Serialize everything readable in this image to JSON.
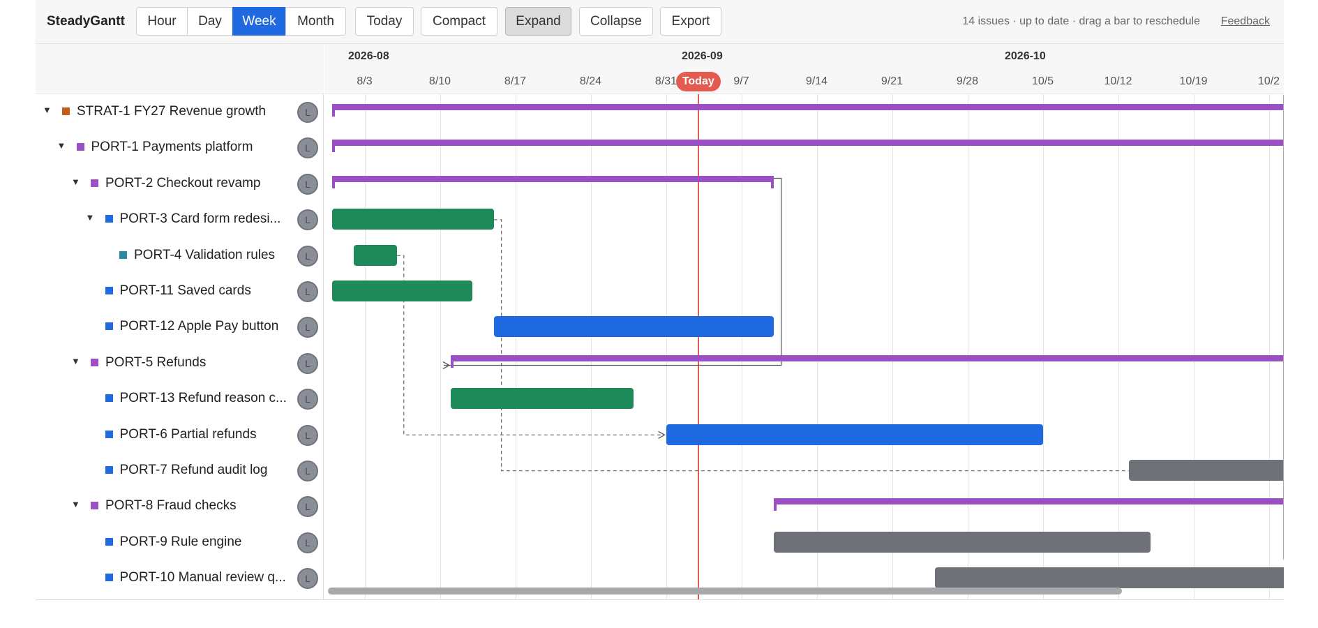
{
  "app": {
    "name": "SteadyGantt"
  },
  "toolbar": {
    "scale_buttons": [
      {
        "label": "Hour",
        "active": false
      },
      {
        "label": "Day",
        "active": false
      },
      {
        "label": "Week",
        "active": true
      },
      {
        "label": "Month",
        "active": false
      }
    ],
    "today_label": "Today",
    "compact_label": "Compact",
    "expand_label": "Expand",
    "expand_pressed": true,
    "collapse_label": "Collapse",
    "export_label": "Export",
    "status_text": "14 issues · up to date · drag a bar to reschedule",
    "feedback_label": "Feedback"
  },
  "timeline": {
    "months": [
      "2026-08",
      "2026-09",
      "2026-10"
    ],
    "weeks": [
      "8/3",
      "8/10",
      "8/17",
      "8/24",
      "8/31",
      "9/7",
      "9/14",
      "9/21",
      "9/28",
      "10/5",
      "10/12",
      "10/19",
      "10/2"
    ],
    "today_label": "Today",
    "today_date": "2026-09-03"
  },
  "colors": {
    "summary": "#9a4fc4",
    "done": "#1e8a5a",
    "in_progress": "#1f6ae0",
    "todo": "#6f7178",
    "today": "#e25a50",
    "strat_square": "#c2601a",
    "epic_square": "#9a4fc4",
    "story_square": "#1f6ae0",
    "subtask_square": "#2a8aa0"
  },
  "rows": [
    {
      "key": "STRAT-1",
      "title": "FY27 Revenue growth",
      "display": "STRAT-1  FY27 Revenue growth",
      "depth": 0,
      "expandable": true,
      "type": "strat",
      "avatar": "L",
      "bar": {
        "kind": "summary",
        "start": "2026-07-31",
        "end": "2026-11-01"
      }
    },
    {
      "key": "PORT-1",
      "title": "Payments platform",
      "display": "PORT-1  Payments platform",
      "depth": 1,
      "expandable": true,
      "type": "epic",
      "avatar": "L",
      "bar": {
        "kind": "summary",
        "start": "2026-07-31",
        "end": "2026-11-01"
      }
    },
    {
      "key": "PORT-2",
      "title": "Checkout revamp",
      "display": "PORT-2  Checkout revamp",
      "depth": 2,
      "expandable": true,
      "type": "epic",
      "avatar": "L",
      "bar": {
        "kind": "summary",
        "start": "2026-07-31",
        "end": "2026-09-10"
      }
    },
    {
      "key": "PORT-3",
      "title": "Card form redesi...",
      "display": "PORT-3  Card form redesi...",
      "depth": 3,
      "expandable": true,
      "type": "story",
      "avatar": "L",
      "bar": {
        "kind": "done",
        "start": "2026-07-31",
        "end": "2026-08-15"
      }
    },
    {
      "key": "PORT-4",
      "title": "Validation rules",
      "display": "PORT-4  Validation rules",
      "depth": 4,
      "expandable": false,
      "type": "subtask",
      "avatar": "L",
      "bar": {
        "kind": "done",
        "start": "2026-08-02",
        "end": "2026-08-06"
      }
    },
    {
      "key": "PORT-11",
      "title": "Saved cards",
      "display": "PORT-11  Saved cards",
      "depth": 3,
      "expandable": false,
      "type": "story",
      "avatar": "L",
      "bar": {
        "kind": "done",
        "start": "2026-07-31",
        "end": "2026-08-13"
      }
    },
    {
      "key": "PORT-12",
      "title": "Apple Pay button",
      "display": "PORT-12  Apple Pay button",
      "depth": 3,
      "expandable": false,
      "type": "story",
      "avatar": "L",
      "bar": {
        "kind": "in_progress",
        "start": "2026-08-15",
        "end": "2026-09-10"
      }
    },
    {
      "key": "PORT-5",
      "title": "Refunds",
      "display": "PORT-5  Refunds",
      "depth": 2,
      "expandable": true,
      "type": "epic",
      "avatar": "L",
      "bar": {
        "kind": "summary",
        "start": "2026-08-11",
        "end": "2026-11-01"
      }
    },
    {
      "key": "PORT-13",
      "title": "Refund reason c...",
      "display": "PORT-13  Refund reason c...",
      "depth": 3,
      "expandable": false,
      "type": "story",
      "avatar": "L",
      "bar": {
        "kind": "done",
        "start": "2026-08-11",
        "end": "2026-08-28"
      }
    },
    {
      "key": "PORT-6",
      "title": "Partial refunds",
      "display": "PORT-6  Partial refunds",
      "depth": 3,
      "expandable": false,
      "type": "story",
      "avatar": "L",
      "bar": {
        "kind": "in_progress",
        "start": "2026-08-31",
        "end": "2026-10-05"
      }
    },
    {
      "key": "PORT-7",
      "title": "Refund audit log",
      "display": "PORT-7  Refund audit log",
      "depth": 3,
      "expandable": false,
      "type": "story",
      "avatar": "L",
      "bar": {
        "kind": "todo",
        "start": "2026-10-13",
        "end": "2026-11-01"
      }
    },
    {
      "key": "PORT-8",
      "title": "Fraud checks",
      "display": "PORT-8  Fraud checks",
      "depth": 2,
      "expandable": true,
      "type": "epic",
      "avatar": "L",
      "bar": {
        "kind": "summary",
        "start": "2026-09-10",
        "end": "2026-11-01"
      }
    },
    {
      "key": "PORT-9",
      "title": "Rule engine",
      "display": "PORT-9  Rule engine",
      "depth": 3,
      "expandable": false,
      "type": "story",
      "avatar": "L",
      "bar": {
        "kind": "todo",
        "start": "2026-09-10",
        "end": "2026-10-15"
      }
    },
    {
      "key": "PORT-10",
      "title": "Manual review q...",
      "display": "PORT-10  Manual review q...",
      "depth": 3,
      "expandable": false,
      "type": "story",
      "avatar": "L",
      "bar": {
        "kind": "todo",
        "start": "2026-09-25",
        "end": "2026-11-01"
      }
    }
  ],
  "dependencies": [
    {
      "from": "PORT-2",
      "to": "PORT-5"
    },
    {
      "from": "PORT-4",
      "to": "PORT-6"
    },
    {
      "from": "PORT-3",
      "to": "PORT-7"
    }
  ]
}
